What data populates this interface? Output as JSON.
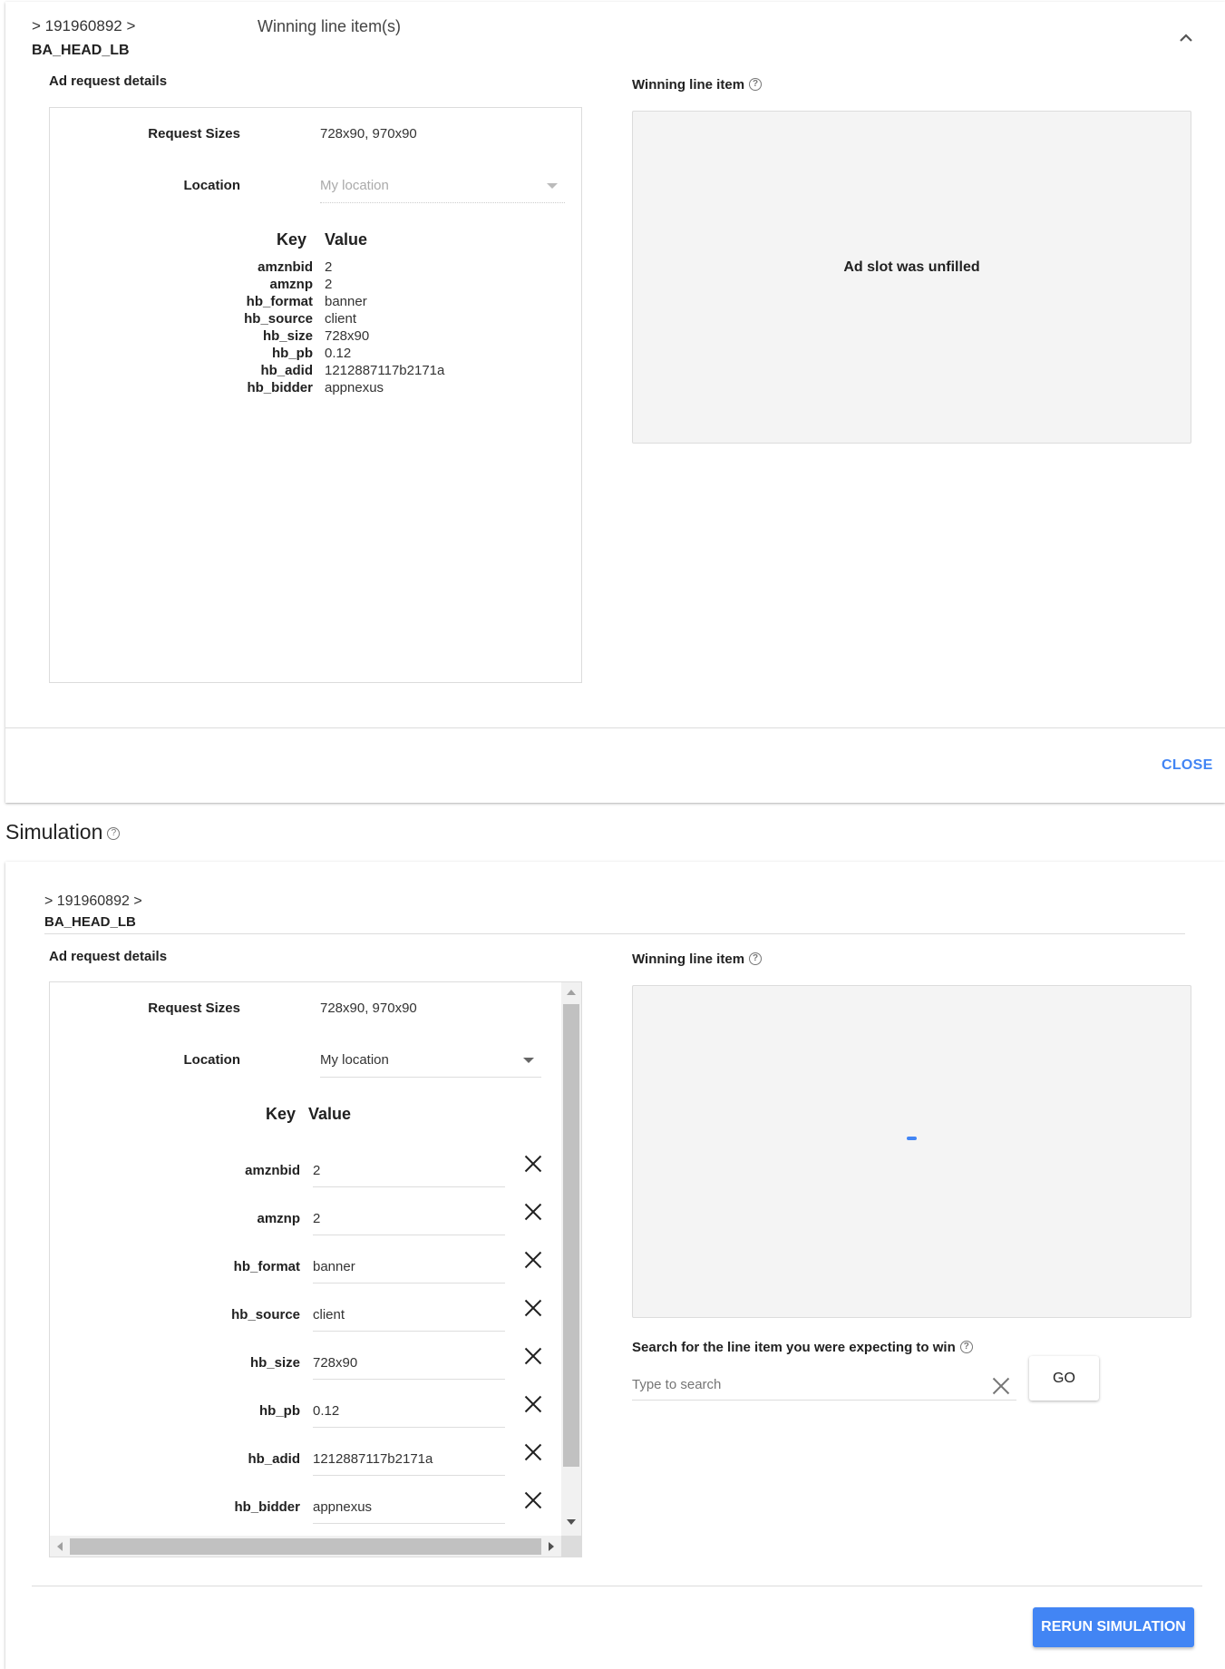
{
  "result_card": {
    "breadcrumb": "> 191960892 >",
    "ad_unit": "BA_HEAD_LB",
    "header_title": "Winning line item(s)",
    "collapse_icon": "chevron-up-icon",
    "ad_request": {
      "title": "Ad request details",
      "request_sizes_label": "Request Sizes",
      "request_sizes_value": "728x90, 970x90",
      "location_label": "Location",
      "location_value": "My location",
      "key_header": "Key",
      "value_header": "Value",
      "targeting": [
        {
          "key": "amznbid",
          "value": "2"
        },
        {
          "key": "amznp",
          "value": "2"
        },
        {
          "key": "hb_format",
          "value": "banner"
        },
        {
          "key": "hb_source",
          "value": "client"
        },
        {
          "key": "hb_size",
          "value": "728x90"
        },
        {
          "key": "hb_pb",
          "value": "0.12"
        },
        {
          "key": "hb_adid",
          "value": "1212887117b2171a"
        },
        {
          "key": "hb_bidder",
          "value": "appnexus"
        }
      ]
    },
    "winning": {
      "title": "Winning line item",
      "help_icon": "help-circle-icon",
      "message": "Ad slot was unfilled"
    },
    "close_label": "CLOSE"
  },
  "simulation": {
    "title": "Simulation",
    "help_icon": "help-circle-icon",
    "breadcrumb": "> 191960892 >",
    "ad_unit": "BA_HEAD_LB",
    "ad_request": {
      "title": "Ad request details",
      "request_sizes_label": "Request Sizes",
      "request_sizes_value": "728x90, 970x90",
      "location_label": "Location",
      "location_value": "My location",
      "key_header": "Key",
      "value_header": "Value",
      "targeting": [
        {
          "key": "amznbid",
          "value": "2"
        },
        {
          "key": "amznp",
          "value": "2"
        },
        {
          "key": "hb_format",
          "value": "banner"
        },
        {
          "key": "hb_source",
          "value": "client"
        },
        {
          "key": "hb_size",
          "value": "728x90"
        },
        {
          "key": "hb_pb",
          "value": "0.12"
        },
        {
          "key": "hb_adid",
          "value": "1212887117b2171a"
        },
        {
          "key": "hb_bidder",
          "value": "appnexus"
        }
      ]
    },
    "winning": {
      "title": "Winning line item",
      "help_icon": "help-circle-icon",
      "loading": true
    },
    "search": {
      "label": "Search for the line item you were expecting to win",
      "placeholder": "Type to search",
      "value": "",
      "go_label": "GO"
    },
    "rerun_label": "RERUN SIMULATION"
  },
  "colors": {
    "accent": "#4285f4",
    "panel_gray": "#f4f4f4",
    "border": "#dcdcdc"
  }
}
